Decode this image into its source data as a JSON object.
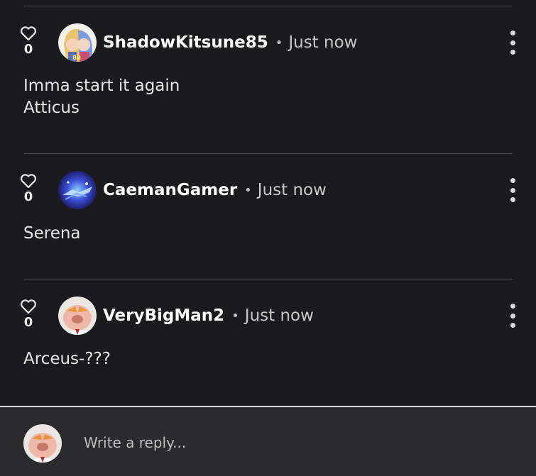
{
  "comments": [
    {
      "likes": "0",
      "username": "ShadowKitsune85",
      "separator": "•",
      "time": "Just now",
      "lines": [
        "Imma start it again",
        "Atticus"
      ]
    },
    {
      "likes": "0",
      "username": "CaemanGamer",
      "separator": "•",
      "time": "Just now",
      "lines": [
        "Serena"
      ]
    },
    {
      "likes": "0",
      "username": "VeryBigMan2",
      "separator": "•",
      "time": "Just now",
      "lines": [
        "Arceus-???"
      ]
    }
  ],
  "reply": {
    "placeholder": "Write a reply..."
  }
}
